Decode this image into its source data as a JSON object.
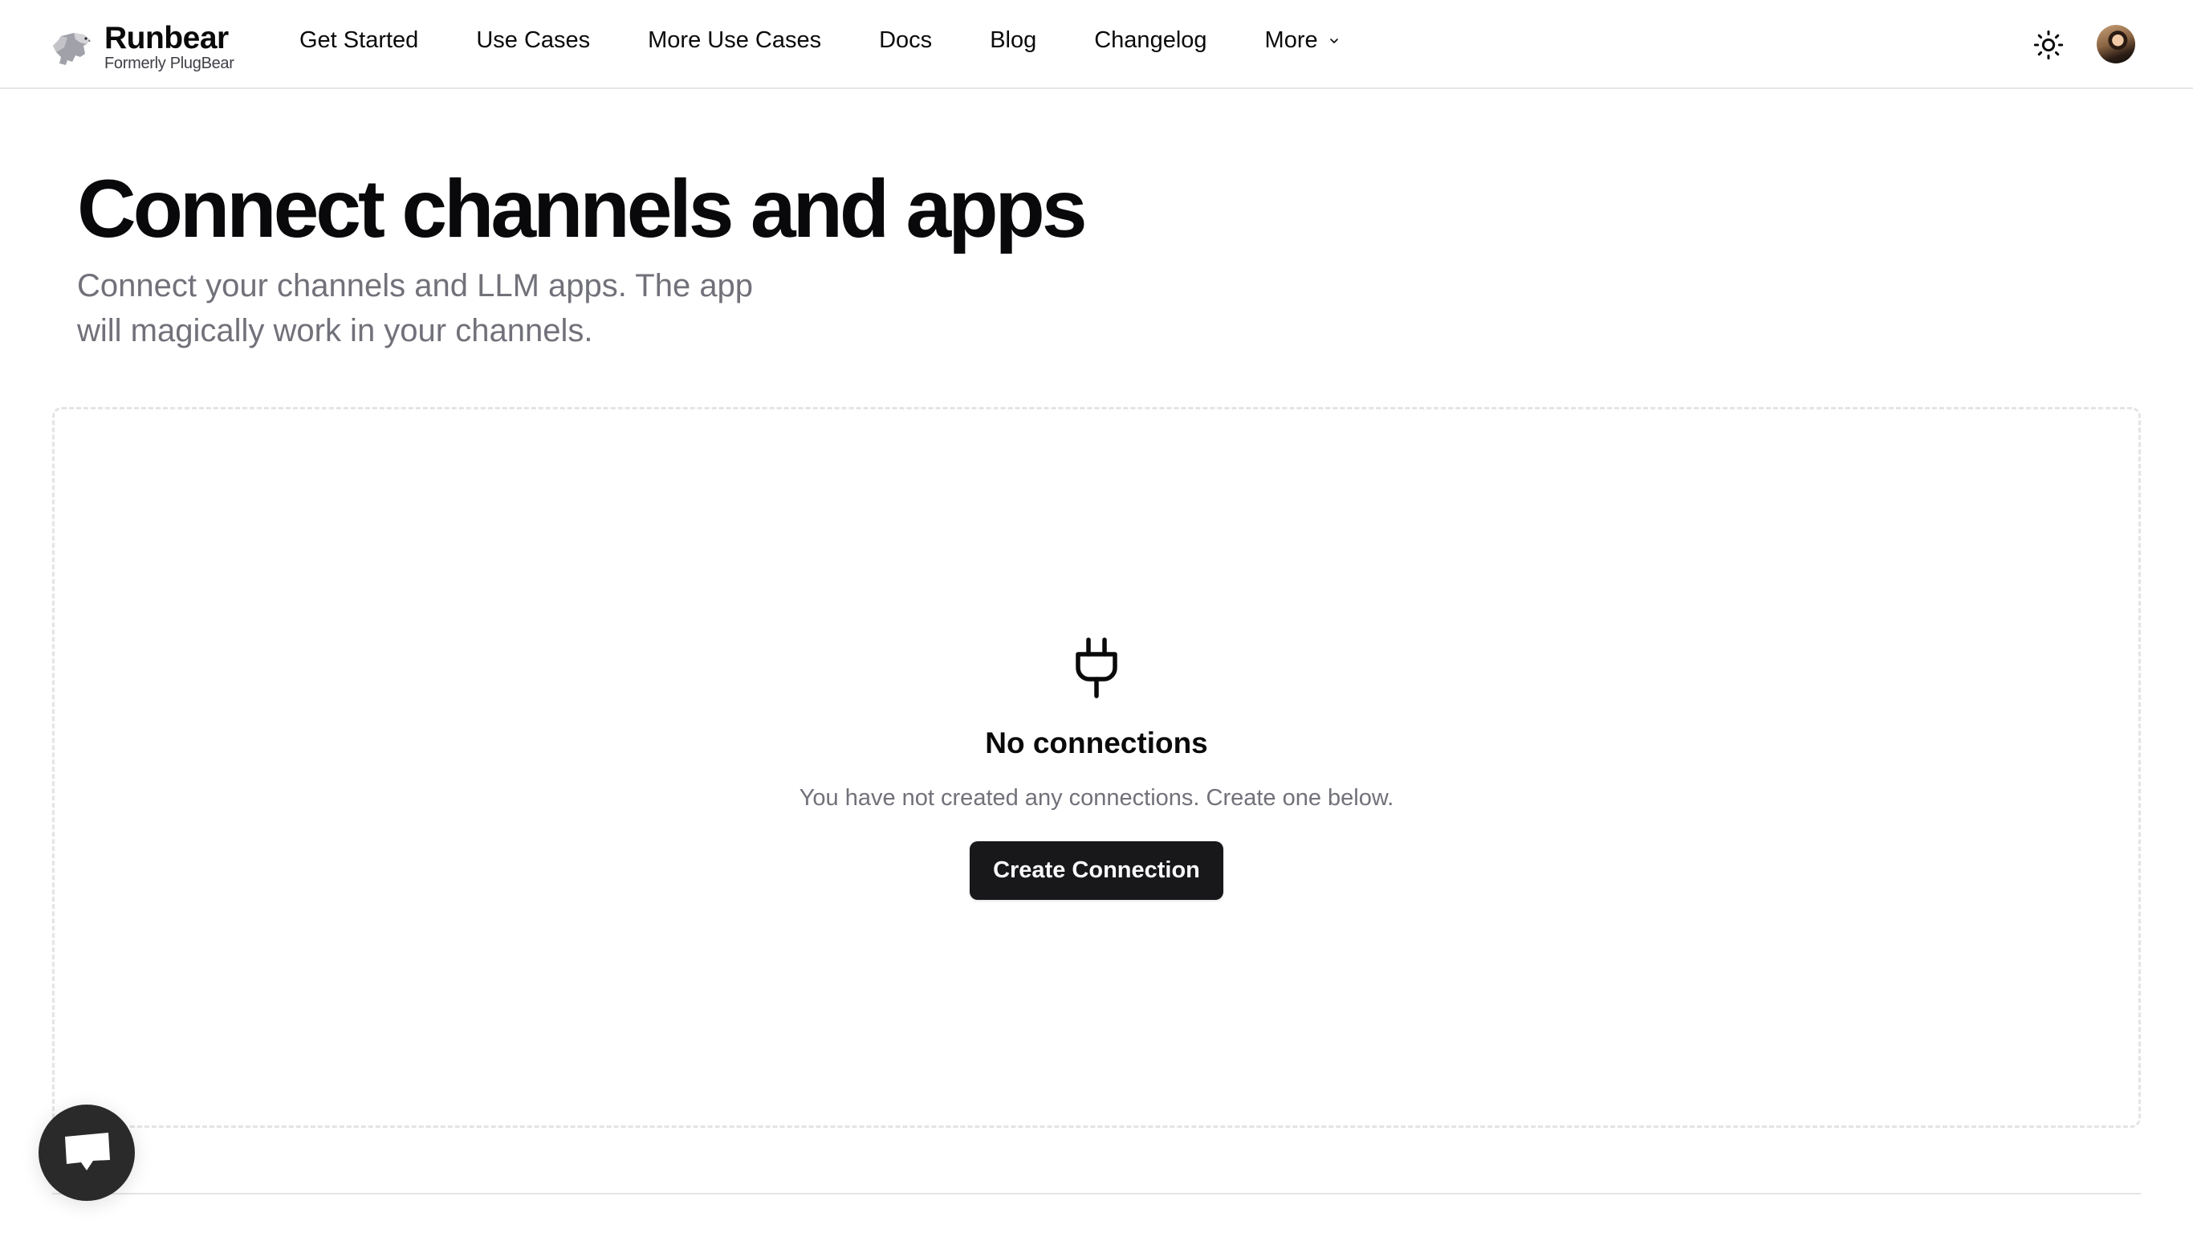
{
  "brand": {
    "name": "Runbear",
    "tagline": "Formerly PlugBear",
    "logo_icon": "running-bear-icon"
  },
  "nav": {
    "items": [
      {
        "label": "Get Started"
      },
      {
        "label": "Use Cases"
      },
      {
        "label": "More Use Cases"
      },
      {
        "label": "Docs"
      },
      {
        "label": "Blog"
      },
      {
        "label": "Changelog"
      },
      {
        "label": "More",
        "has_dropdown": true
      }
    ],
    "theme_toggle_icon": "sun-icon",
    "avatar_icon": "user-avatar"
  },
  "page": {
    "title": "Connect channels and apps",
    "subtitle": "Connect your channels and LLM apps. The app will magically work in your channels."
  },
  "empty_state": {
    "icon": "plug-icon",
    "title": "No connections",
    "description": "You have not created any connections. Create one below.",
    "button_label": "Create Connection"
  },
  "chat_widget": {
    "icon": "chat-bubble-icon"
  },
  "colors": {
    "primary_button": "#18181b",
    "muted_text": "#71717a",
    "border": "#e4e4e7"
  }
}
